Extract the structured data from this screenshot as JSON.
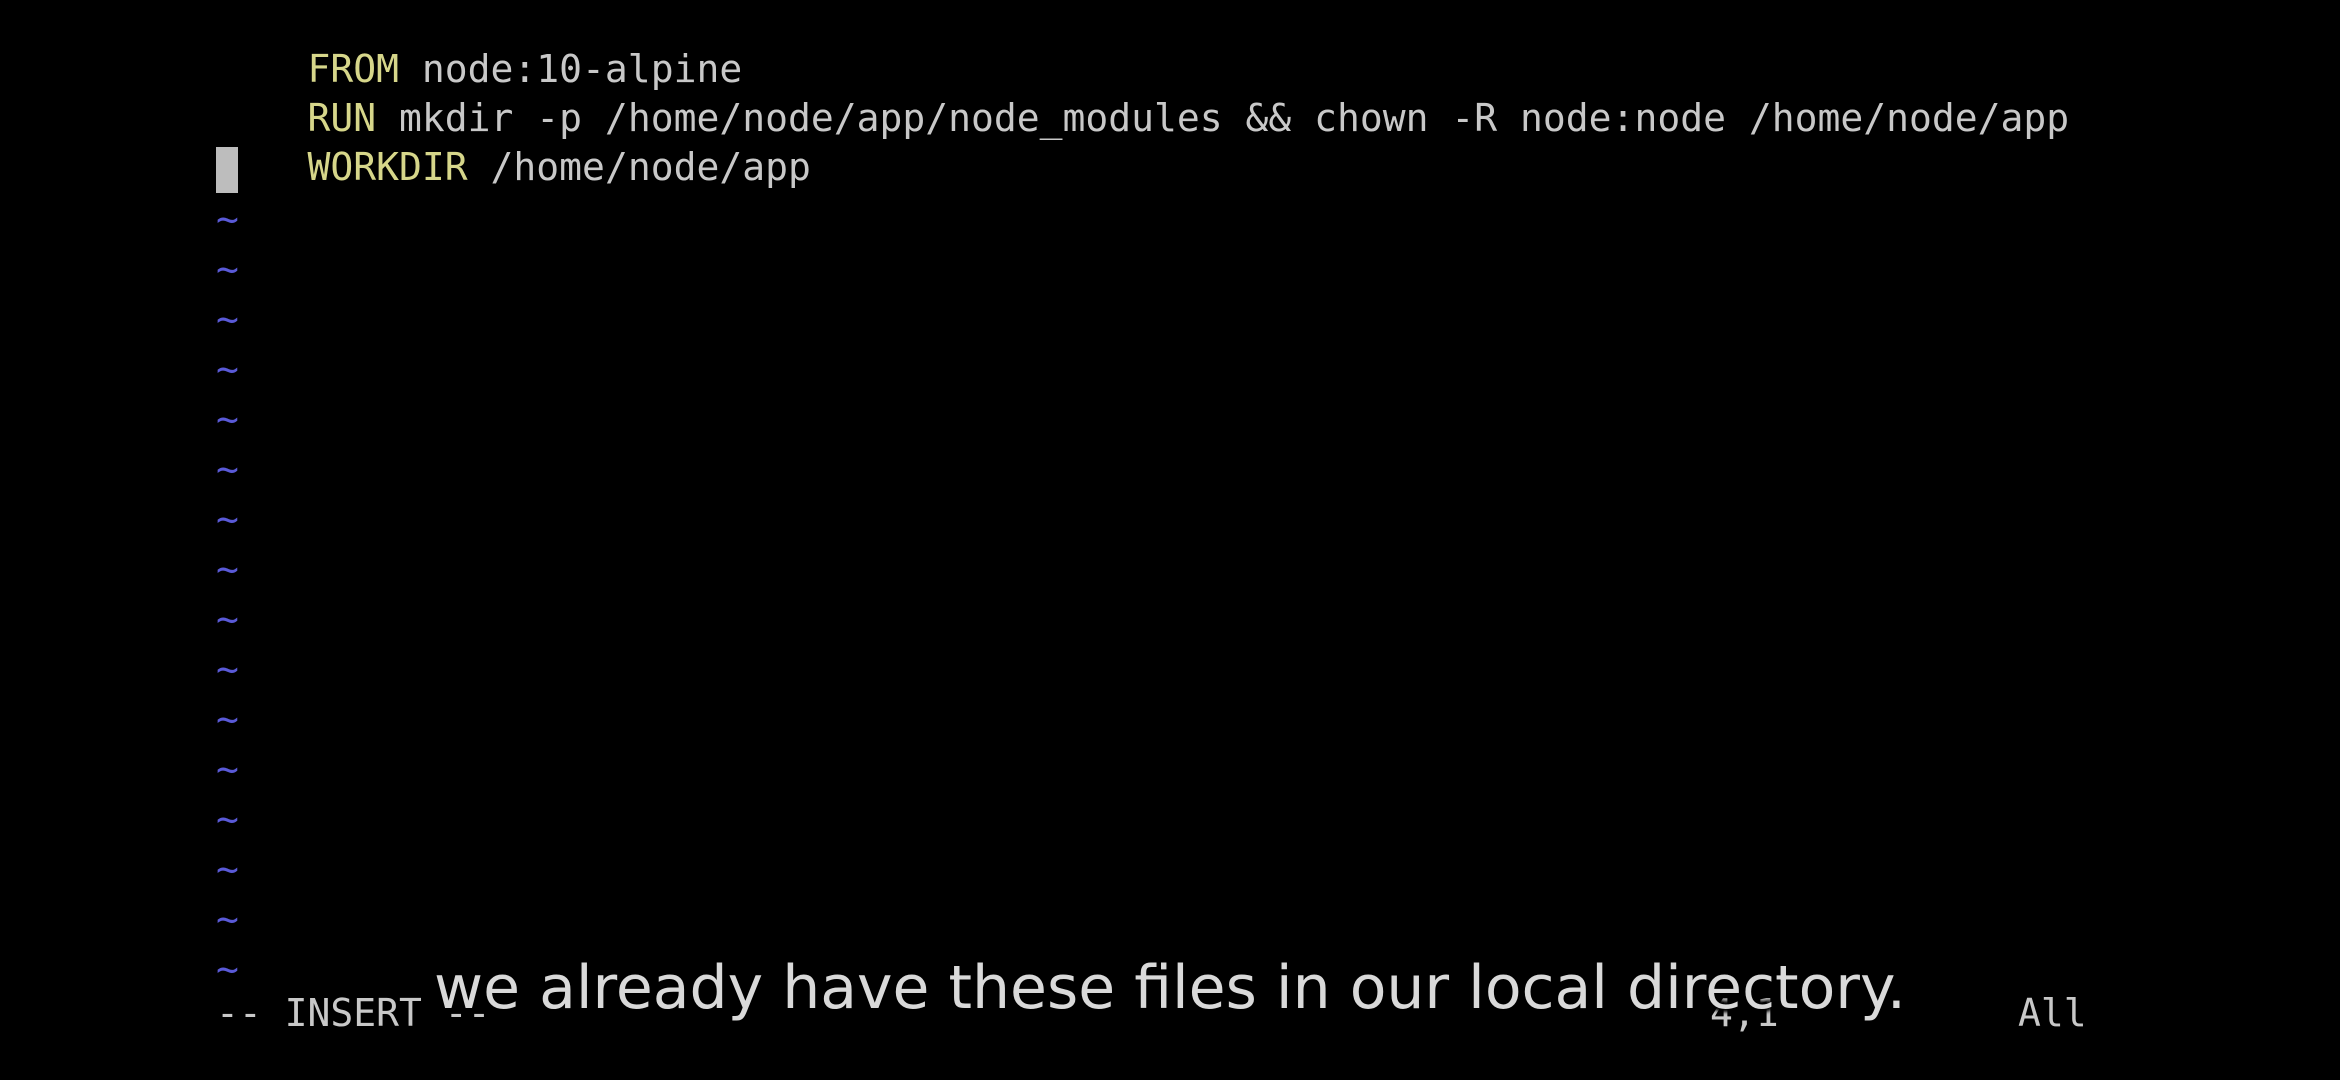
{
  "editor": {
    "lines": [
      {
        "keyword": "FROM",
        "text": " node:10-alpine"
      },
      {
        "keyword": "RUN",
        "text": " mkdir -p /home/node/app/node_modules && chown -R node:node /home/node/app"
      },
      {
        "keyword": "WORKDIR",
        "text": " /home/node/app"
      }
    ],
    "tilde": "~",
    "tilde_color": "#5a5ad8",
    "keyword_color": "#d6d68a"
  },
  "statusline": {
    "mode": "-- INSERT --",
    "position": "4,1",
    "scroll": "All"
  },
  "subtitle": "we already have these files in our local directory."
}
